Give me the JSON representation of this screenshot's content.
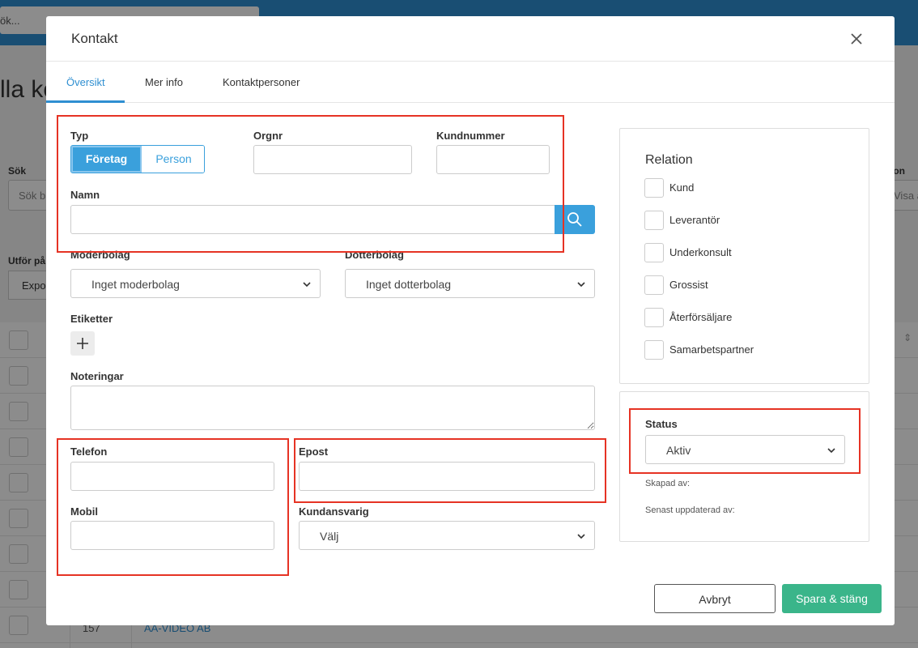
{
  "background": {
    "search_text": "ök...",
    "page_title": "lla ko",
    "search_label": "Sök",
    "search_placeholder": "Sök b",
    "right_label": "ion",
    "right_select": "Visa a",
    "action_label": "Utför på",
    "export_button": "Expo",
    "row_number": "157",
    "row_name": "AA-VIDEO AB"
  },
  "modal": {
    "title": "Kontakt",
    "tabs": [
      {
        "label": "Översikt",
        "active": true
      },
      {
        "label": "Mer info",
        "active": false
      },
      {
        "label": "Kontaktpersoner",
        "active": false
      }
    ],
    "form": {
      "type_label": "Typ",
      "type_options": [
        "Företag",
        "Person"
      ],
      "type_selected": "Företag",
      "orgnr_label": "Orgnr",
      "orgnr_value": "",
      "customer_number_label": "Kundnummer",
      "customer_number_value": "",
      "name_label": "Namn",
      "name_value": "",
      "parent_label": "Moderbolag",
      "parent_value": "Inget moderbolag",
      "subsidiary_label": "Dotterbolag",
      "subsidiary_value": "Inget dotterbolag",
      "tags_label": "Etiketter",
      "notes_label": "Noteringar",
      "phone_label": "Telefon",
      "email_label": "Epost",
      "mobile_label": "Mobil",
      "account_manager_label": "Kundansvarig",
      "account_manager_value": "Välj"
    },
    "relation": {
      "title": "Relation",
      "items": [
        "Kund",
        "Leverantör",
        "Underkonsult",
        "Grossist",
        "Återförsäljare",
        "Samarbetspartner"
      ]
    },
    "status": {
      "label": "Status",
      "value": "Aktiv",
      "created_by_label": "Skapad av:",
      "updated_by_label": "Senast uppdaterad av:"
    },
    "buttons": {
      "cancel": "Avbryt",
      "save": "Spara & stäng"
    }
  },
  "colors": {
    "accent": "#2f8fd1",
    "primary_button": "#3aa0dc",
    "save_button": "#3ab58a",
    "highlight": "#e63324"
  }
}
